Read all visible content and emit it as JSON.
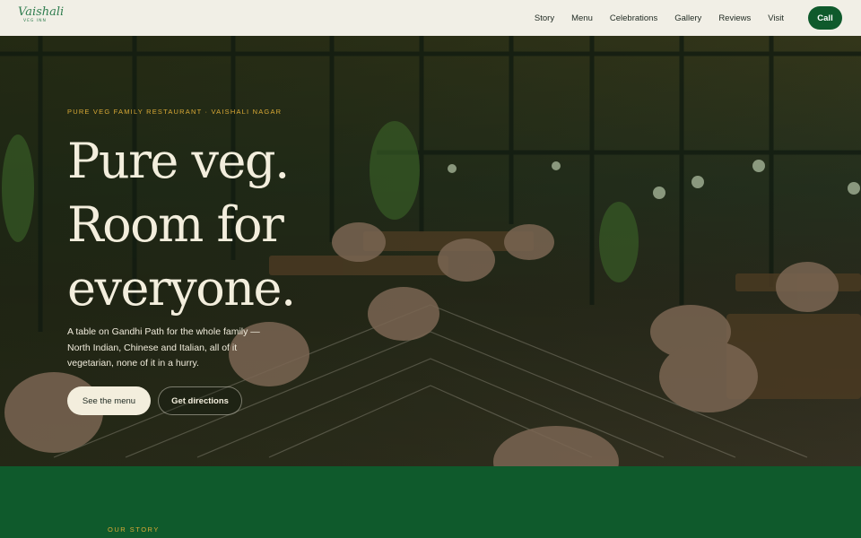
{
  "brand": {
    "logo_script": "Vaishali",
    "logo_sub": "VEG INN"
  },
  "nav": {
    "links": [
      "Story",
      "Menu",
      "Celebrations",
      "Gallery",
      "Reviews",
      "Visit"
    ],
    "call_label": "Call"
  },
  "hero": {
    "eyebrow": "PURE VEG FAMILY RESTAURANT · VAISHALI NAGAR",
    "title_lines": [
      "Pure veg.",
      "Room for",
      "everyone."
    ],
    "description": "A table on Gandhi Path for the whole family — North Indian, Chinese and Italian, all of it vegetarian, none of it in a hurry.",
    "primary_button": "See the menu",
    "secondary_button": "Get directions"
  },
  "story": {
    "label": "OUR STORY"
  },
  "colors": {
    "brand_green": "#0f5a2c",
    "nav_bg": "#f1efe6",
    "accent_gold": "#d9a936",
    "cream": "#f3eedd"
  }
}
